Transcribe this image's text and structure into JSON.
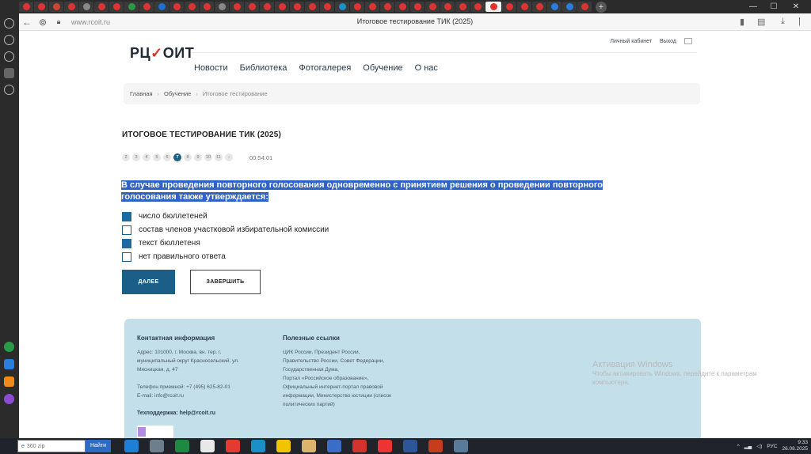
{
  "browser": {
    "url": "www.rcoit.ru",
    "tab_title": "Итоговое тестирование ТИК (2025)"
  },
  "header": {
    "logo": {
      "part1": "РЦ",
      "check": "✓",
      "part2": "ОИТ"
    },
    "top_links": [
      "Личный кабинет",
      "Выход"
    ],
    "nav": [
      "Новости",
      "Библиотека",
      "Фотогалерея",
      "Обучение",
      "О нас"
    ]
  },
  "breadcrumbs": [
    "Главная",
    "Обучение",
    "Итоговое тестирование"
  ],
  "test": {
    "title": "ИТОГОВОЕ ТЕСТИРОВАНИЕ ТИК (2025)",
    "pages": [
      "2",
      "3",
      "4",
      "5",
      "6",
      "7",
      "8",
      "9",
      "10",
      "11",
      "›"
    ],
    "active_page": "7",
    "timer": "00:54:01",
    "question": "В случае проведения повторного голосования одновременно с принятием решения о проведении повторного голосования также утверждается:",
    "answers": [
      {
        "text": "число бюллетеней",
        "checked": true
      },
      {
        "text": "состав членов участковой избирательной комиссии",
        "checked": false
      },
      {
        "text": "текст бюллетеня",
        "checked": true
      },
      {
        "text": "нет правильного ответа",
        "checked": false
      }
    ],
    "next_label": "ДАЛЕЕ",
    "finish_label": "ЗАВЕРШИТЬ"
  },
  "footer": {
    "contacts_title": "Контактная информация",
    "address_lines": [
      "Адрес: 101000, г. Москва, вн. тер. г.",
      "муниципальный округ Красносельский, ул.",
      "Мясницкая, д. 47"
    ],
    "phone": "Телефон приемной: +7 (495) 625-82-01",
    "email": "E-mail: info@rcoit.ru",
    "support_label": "Техподдержка:",
    "support_email": "help@rcoit.ru",
    "links_title": "Полезные ссылки",
    "links_lines": [
      "ЦИК России, Президент России,",
      "Правительство России, Совет Федерации,",
      "Государственная Дума,",
      "Портал «Российское образование»,",
      "Официальный интернет-портал правовой",
      "информации, Министерство юстиции (список",
      "политических партий)"
    ]
  },
  "watermark": {
    "title": "Активация Windows",
    "text": "Чтобы активировать Windows, перейдите к параметрам компьютера."
  },
  "taskbar": {
    "search_value": "360 zip",
    "search_button": "Найти",
    "lang": "РУС",
    "time": "9:33",
    "date": "26.08.2025"
  }
}
